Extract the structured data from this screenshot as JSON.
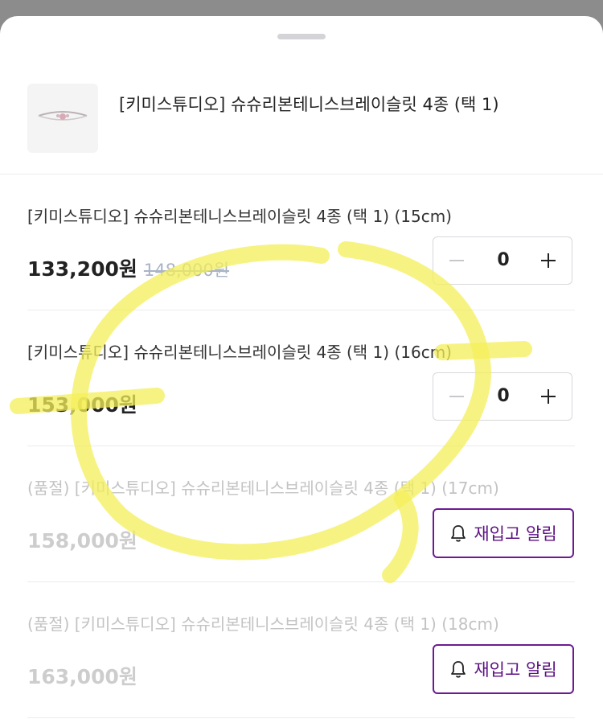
{
  "product": {
    "title": "[키미스튜디오] 슈슈리본테니스브레이슬릿 4종 (택 1)"
  },
  "options": [
    {
      "name": "[키미스튜디오] 슈슈리본테니스브레이슬릿 4종 (택 1) (15cm)",
      "price": "133,200원",
      "original_price": "148,000원",
      "quantity": "0",
      "sold_out": false
    },
    {
      "name": "[키미스튜디오] 슈슈리본테니스브레이슬릿 4종 (택 1) (16cm)",
      "price": "153,000원",
      "quantity": "0",
      "sold_out": false
    },
    {
      "name": "(품절) [키미스튜디오] 슈슈리본테니스브레이슬릿 4종 (택 1) (17cm)",
      "price": "158,000원",
      "sold_out": true,
      "notify_label": "재입고 알림"
    },
    {
      "name": "(품절) [키미스튜디오] 슈슈리본테니스브레이슬릿 4종 (택 1) (18cm)",
      "price": "163,000원",
      "sold_out": true,
      "notify_label": "재입고 알림"
    }
  ],
  "colors": {
    "accent": "#5d1184",
    "highlight": "#f4ef5a",
    "strikethrough": "#a9b4c7"
  },
  "icons": {
    "minus": "minus-icon",
    "plus": "plus-icon",
    "bell": "bell-icon"
  }
}
